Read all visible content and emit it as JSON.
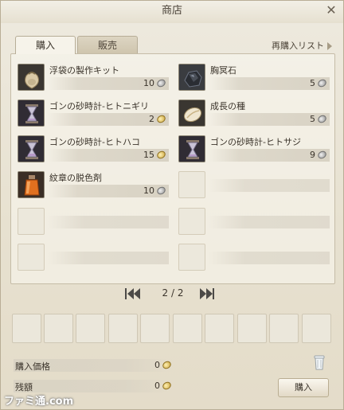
{
  "window": {
    "title": "商店",
    "close_glyph": "✕"
  },
  "tabs": [
    {
      "label": "購入",
      "active": true
    },
    {
      "label": "販売",
      "active": false
    }
  ],
  "rebuy_link": "再購入リスト",
  "items": [
    {
      "name": "浮袋の製作キット",
      "price": "10",
      "currency": "silver",
      "icon": "bag-icon"
    },
    {
      "name": "胸冥石",
      "price": "5",
      "currency": "silver",
      "icon": "dark-stone-icon"
    },
    {
      "name": "ゴンの砂時計-ヒトニギリ",
      "price": "2",
      "currency": "gold",
      "icon": "hourglass-icon"
    },
    {
      "name": "成長の種",
      "price": "5",
      "currency": "silver",
      "icon": "seed-icon"
    },
    {
      "name": "ゴンの砂時計-ヒトハコ",
      "price": "15",
      "currency": "gold",
      "icon": "hourglass-icon"
    },
    {
      "name": "ゴンの砂時計-ヒトサジ",
      "price": "9",
      "currency": "silver",
      "icon": "hourglass-icon"
    },
    {
      "name": "紋章の脱色剤",
      "price": "10",
      "currency": "silver",
      "icon": "bottle-icon"
    }
  ],
  "pagination": {
    "text": "2 / 2"
  },
  "summary": {
    "purchase_price_label": "購入価格",
    "purchase_price_value": "0",
    "balance_label": "残額",
    "balance_value": "0"
  },
  "buy_button": "購入",
  "watermark": "ファミ通.com"
}
